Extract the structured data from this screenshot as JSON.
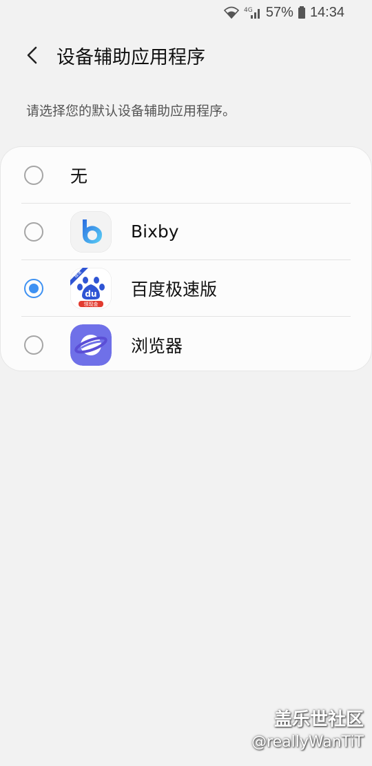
{
  "status_bar": {
    "network": "4G",
    "battery": "57%",
    "time": "14:34"
  },
  "header": {
    "title": "设备辅助应用程序"
  },
  "subtitle": "请选择您的默认设备辅助应用程序。",
  "options": [
    {
      "label": "无",
      "selected": false,
      "icon": null
    },
    {
      "label": "Bixby",
      "selected": false,
      "icon": "bixby-icon"
    },
    {
      "label": "百度极速版",
      "selected": true,
      "icon": "baidu-lite-icon"
    },
    {
      "label": "浏览器",
      "selected": false,
      "icon": "samsung-internet-icon"
    }
  ],
  "baidu_icon_text": {
    "badge": "极速",
    "logo": "du",
    "ribbon": "领现金"
  },
  "watermark": {
    "title": "盖乐世社区",
    "handle": "@reallyWanTiT"
  },
  "colors": {
    "accent": "#3e91f2",
    "background": "#f2f2f2",
    "card": "#fcfcfc"
  }
}
